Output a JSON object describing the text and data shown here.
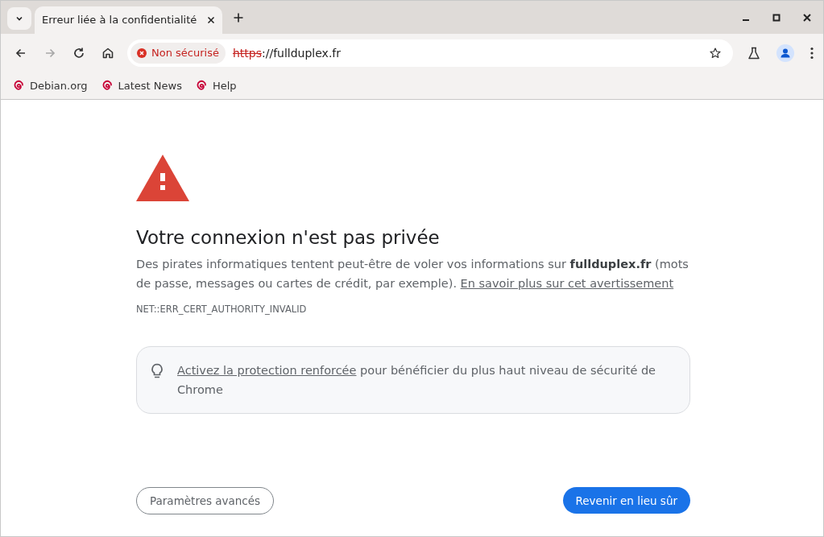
{
  "tab": {
    "title": "Erreur liée à la confidentialité",
    "selected": true
  },
  "toolbar": {
    "buttons": [
      {
        "kind": "back",
        "disabled": false
      },
      {
        "kind": "forward",
        "disabled": true
      },
      {
        "kind": "reload",
        "disabled": false
      },
      {
        "kind": "home",
        "disabled": false
      }
    ]
  },
  "address_bar": {
    "security_chip": "Non sécurisé",
    "scheme": "https",
    "rest": "://fullduplex.fr"
  },
  "bookmarks": [
    {
      "label": "Debian.org"
    },
    {
      "label": "Latest News"
    },
    {
      "label": "Help"
    }
  ],
  "page": {
    "heading": "Votre connexion n'est pas privée",
    "description": "Des pirates informatiques tentent peut-être de voler vos informations sur **fullduplex.fr** (mots de passe, messages ou cartes de crédit, par exemple).",
    "learn_more_link": "En savoir plus sur cet avertissement",
    "error_code": "NET::ERR_CERT_AUTHORITY_INVALID",
    "tip": {
      "link": "Activez la protection renforcée",
      "text": "pour bénéficier du plus haut niveau de sécurité de Chrome"
    },
    "buttons": [
      {
        "label": "Paramètres avancés",
        "kind": "secondary"
      },
      {
        "label": "Revenir en lieu sûr",
        "kind": "primary"
      }
    ]
  }
}
